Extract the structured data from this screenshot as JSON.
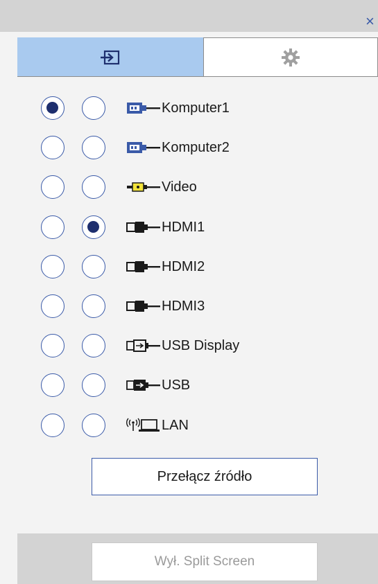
{
  "window": {
    "close_glyph": "×"
  },
  "tabs": [
    {
      "name": "input-tab",
      "icon": "input-arrow-icon",
      "active": true
    },
    {
      "name": "settings-tab",
      "icon": "gear-icon",
      "active": false
    }
  ],
  "sources": [
    {
      "label": "Komputer1",
      "icon": "computer-port-icon",
      "col1": true,
      "col2": false
    },
    {
      "label": "Komputer2",
      "icon": "computer-port-icon",
      "col1": false,
      "col2": false
    },
    {
      "label": "Video",
      "icon": "video-rca-icon",
      "col1": false,
      "col2": false
    },
    {
      "label": "HDMI1",
      "icon": "hdmi-plug-icon",
      "col1": false,
      "col2": true
    },
    {
      "label": "HDMI2",
      "icon": "hdmi-plug-icon",
      "col1": false,
      "col2": false
    },
    {
      "label": "HDMI3",
      "icon": "hdmi-plug-icon",
      "col1": false,
      "col2": false
    },
    {
      "label": "USB Display",
      "icon": "usb-display-icon",
      "col1": false,
      "col2": false
    },
    {
      "label": "USB",
      "icon": "usb-icon",
      "col1": false,
      "col2": false
    },
    {
      "label": "LAN",
      "icon": "lan-wireless-icon",
      "col1": false,
      "col2": false
    }
  ],
  "actions": {
    "switch_source_label": "Przełącz źródło",
    "split_off_label": "Wył. Split Screen"
  },
  "colors": {
    "accent": "#3a5aa8",
    "radio_fill": "#1e2f6e",
    "tab_active": "#a9caef",
    "bar_gray": "#d3d3d3",
    "panel_bg": "#f3f3f3"
  }
}
